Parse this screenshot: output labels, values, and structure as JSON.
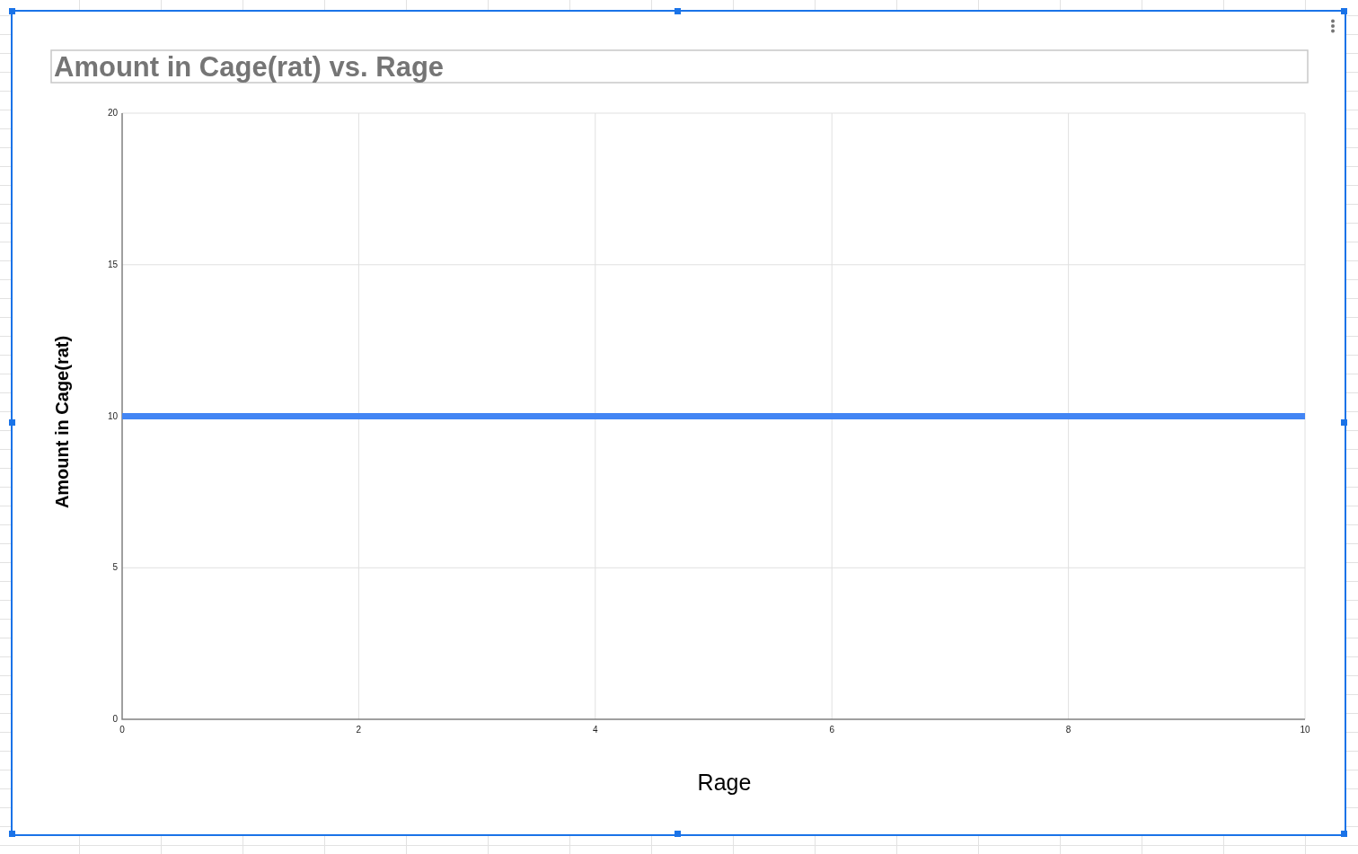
{
  "chart": {
    "chart_data": {
      "type": "line",
      "title": "Amount in Cage(rat) vs. Rage",
      "xlabel": "Rage",
      "ylabel": "Amount in Cage(rat)",
      "x": [
        0,
        10
      ],
      "series": [
        {
          "color": "#4285f4",
          "values": [
            10,
            10
          ]
        }
      ],
      "grid": true,
      "xlim": [
        0,
        10
      ],
      "ylim": [
        0,
        20
      ],
      "xticks": [
        0,
        2,
        4,
        6,
        8,
        10
      ],
      "yticks": [
        0,
        5,
        10,
        15,
        20
      ]
    }
  }
}
